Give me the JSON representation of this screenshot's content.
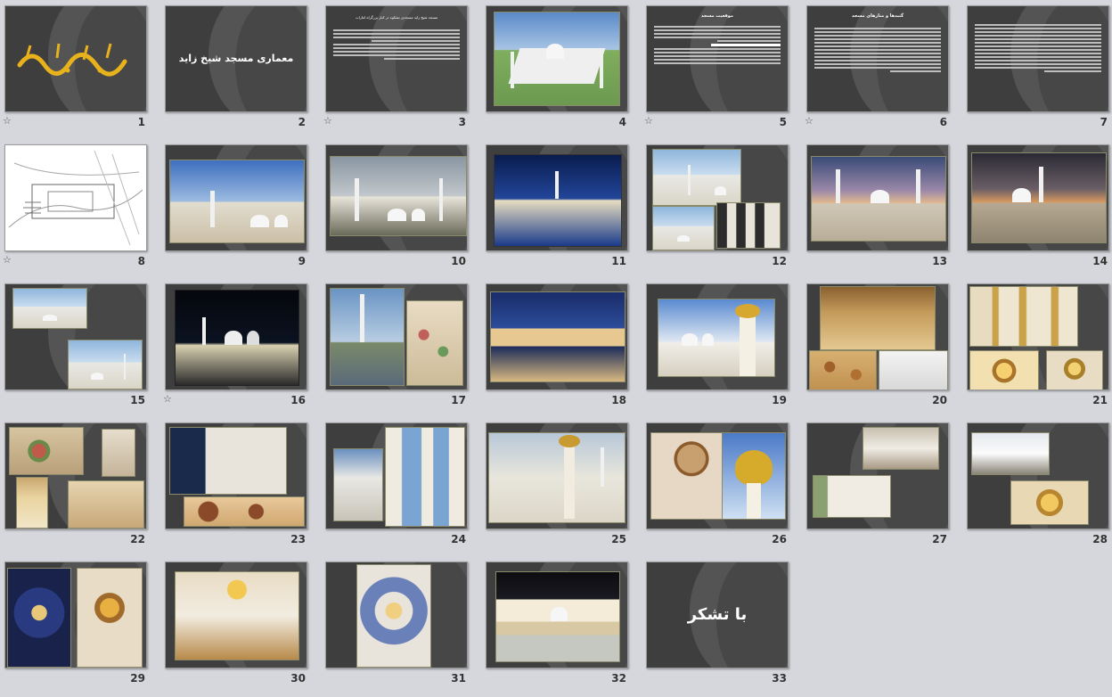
{
  "slides": [
    {
      "num": "1",
      "star": "☆",
      "title": ""
    },
    {
      "num": "2",
      "star": "",
      "title": "معماری مسجد شیخ زاید"
    },
    {
      "num": "3",
      "star": "☆",
      "title": ""
    },
    {
      "num": "4",
      "star": "",
      "title": ""
    },
    {
      "num": "5",
      "star": "☆",
      "title": ""
    },
    {
      "num": "6",
      "star": "☆",
      "title": ""
    },
    {
      "num": "7",
      "star": "",
      "title": ""
    },
    {
      "num": "8",
      "star": "☆",
      "title": ""
    },
    {
      "num": "9",
      "star": "",
      "title": ""
    },
    {
      "num": "10",
      "star": "",
      "title": ""
    },
    {
      "num": "11",
      "star": "",
      "title": ""
    },
    {
      "num": "12",
      "star": "",
      "title": ""
    },
    {
      "num": "13",
      "star": "",
      "title": ""
    },
    {
      "num": "14",
      "star": "",
      "title": ""
    },
    {
      "num": "15",
      "star": "",
      "title": ""
    },
    {
      "num": "16",
      "star": "☆",
      "title": ""
    },
    {
      "num": "17",
      "star": "",
      "title": ""
    },
    {
      "num": "18",
      "star": "",
      "title": ""
    },
    {
      "num": "19",
      "star": "",
      "title": ""
    },
    {
      "num": "20",
      "star": "",
      "title": ""
    },
    {
      "num": "21",
      "star": "",
      "title": ""
    },
    {
      "num": "22",
      "star": "",
      "title": ""
    },
    {
      "num": "23",
      "star": "",
      "title": ""
    },
    {
      "num": "24",
      "star": "",
      "title": ""
    },
    {
      "num": "25",
      "star": "",
      "title": ""
    },
    {
      "num": "26",
      "star": "",
      "title": ""
    },
    {
      "num": "27",
      "star": "",
      "title": ""
    },
    {
      "num": "28",
      "star": "",
      "title": ""
    },
    {
      "num": "29",
      "star": "",
      "title": ""
    },
    {
      "num": "30",
      "star": "",
      "title": ""
    },
    {
      "num": "31",
      "star": "",
      "title": ""
    },
    {
      "num": "32",
      "star": "",
      "title": ""
    },
    {
      "num": "33",
      "star": "",
      "title": "با تشکر"
    }
  ],
  "slide3": {
    "heading": "مسجد شیخ زاید مسجدی بشکوه در کنار بزرگراه امارات"
  },
  "slide5": {
    "heading": "موقعیت مسجد"
  },
  "slide6": {
    "heading": "گنبدها و منارهای مسجد"
  },
  "colors": {
    "background": "#d5d7dc",
    "slide_bg": "#3e3e3e",
    "calligraphy": "#e8b21c"
  }
}
